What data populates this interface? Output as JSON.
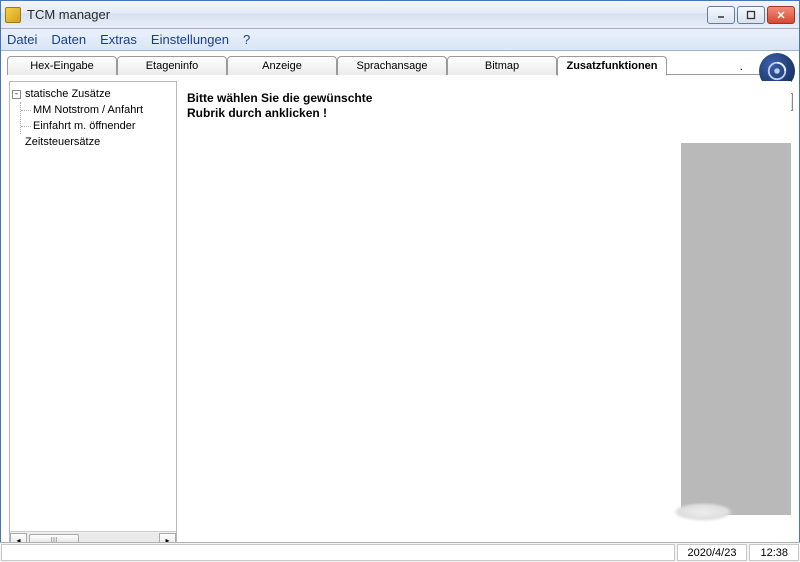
{
  "window": {
    "title": "TCM manager"
  },
  "menu": {
    "items": [
      "Datei",
      "Daten",
      "Extras",
      "Einstellungen",
      "?"
    ]
  },
  "tabs": {
    "items": [
      "Hex-Eingabe",
      "Etageninfo",
      "Anzeige",
      "Sprachansage",
      "Bitmap",
      "Zusatzfunktionen"
    ],
    "active_index": 5,
    "trailing_label": "."
  },
  "tree": {
    "root": {
      "label": "statische Zusätze",
      "expanded": true,
      "children": [
        {
          "label": "MM Notstrom / Anfahrt"
        },
        {
          "label": "Einfahrt m. öffnender"
        }
      ]
    },
    "sibling": {
      "label": "Zeitsteuersätze"
    },
    "hscroll_thumb_label": "III"
  },
  "content": {
    "prompt_line1": "Bitte wählen Sie die gewünschte",
    "prompt_line2": "Rubrik durch anklicken !"
  },
  "statusbar": {
    "date": "2020/4/23",
    "time": "12:38"
  }
}
